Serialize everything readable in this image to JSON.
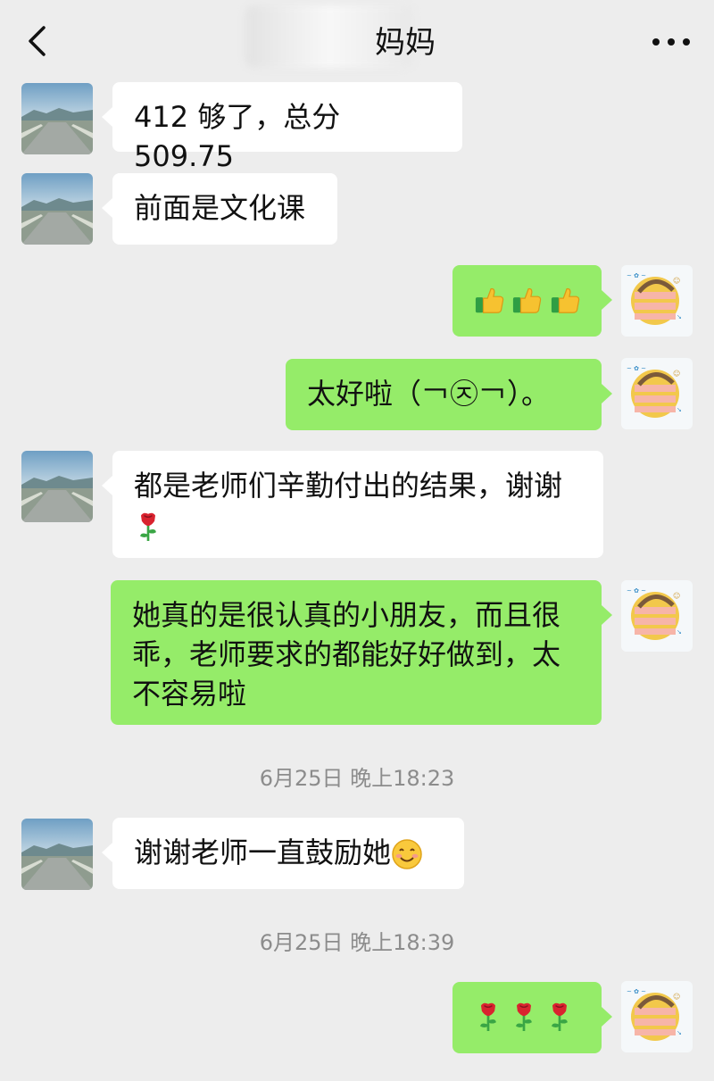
{
  "header": {
    "title": "妈妈",
    "back_icon": "chevron-left-icon",
    "more_icon": "more-dots-icon"
  },
  "messages": [
    {
      "side": "left",
      "text": "412 够了，总分 509.75"
    },
    {
      "side": "left",
      "text": "前面是文化课"
    },
    {
      "side": "right",
      "icons": [
        "thumbs-up-icon",
        "thumbs-up-icon",
        "thumbs-up-icon"
      ]
    },
    {
      "side": "right",
      "text": "太好啦（￢㉨￢）。"
    },
    {
      "side": "left",
      "text": "都是老师们辛勤付出的结果，谢谢",
      "icon": "rose-icon"
    },
    {
      "side": "right",
      "text_lines": [
        "她真的是很认真的小朋友，而且很",
        "乖，老师要求的都能好好做到，太",
        "不容易啦"
      ]
    },
    {
      "side": "left",
      "text": "谢谢老师一直鼓励她",
      "icon": "smiling-face-icon"
    },
    {
      "side": "right",
      "icons": [
        "rose-icon",
        "rose-icon",
        "rose-icon"
      ]
    }
  ],
  "timestamps": [
    "6月25日 晚上18:23",
    "6月25日 晚上18:39"
  ],
  "colors": {
    "background": "#ededed",
    "bubble_self": "#95ec69",
    "bubble_other": "#ffffff",
    "timestamp": "#8c8c8c"
  }
}
